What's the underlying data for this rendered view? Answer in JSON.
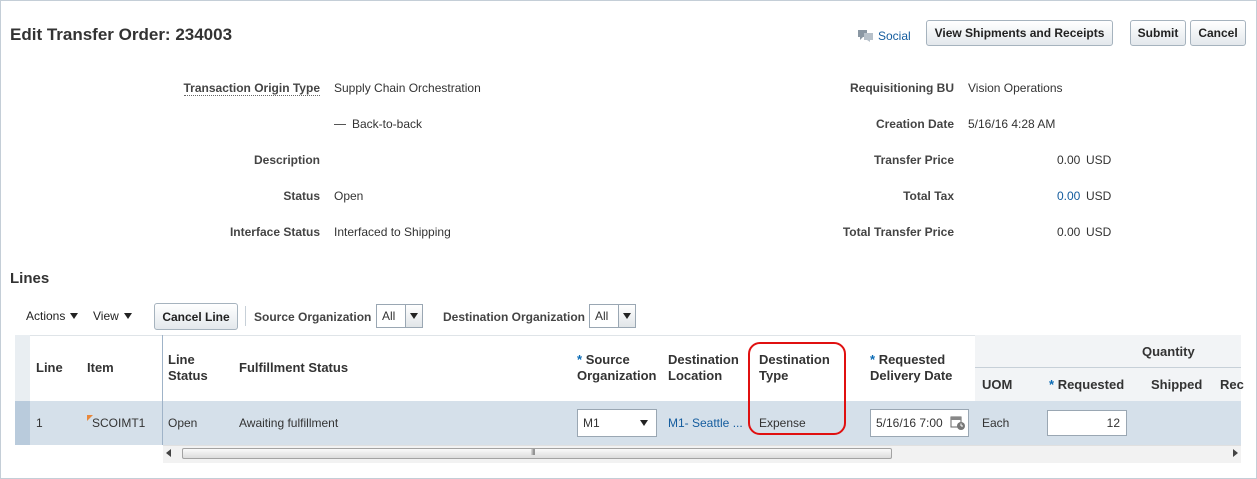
{
  "header": {
    "title": "Edit Transfer Order: 234003",
    "social_label": "Social",
    "view_shipments_label": "View Shipments and Receipts",
    "submit_label": "Submit",
    "cancel_label": "Cancel"
  },
  "details": {
    "transaction_origin_type_label": "Transaction Origin Type",
    "transaction_origin_type_value": "Supply Chain Orchestration",
    "back_to_back": "Back-to-back",
    "description_label": "Description",
    "status_label": "Status",
    "status_value": "Open",
    "interface_status_label": "Interface Status",
    "interface_status_value": "Interfaced to Shipping",
    "requisitioning_bu_label": "Requisitioning BU",
    "requisitioning_bu_value": "Vision Operations",
    "creation_date_label": "Creation Date",
    "creation_date_value": "5/16/16 4:28 AM",
    "transfer_price_label": "Transfer Price",
    "transfer_price_value": "0.00",
    "total_tax_label": "Total Tax",
    "total_tax_value": "0.00",
    "total_transfer_price_label": "Total Transfer Price",
    "total_transfer_price_value": "0.00",
    "currency": "USD"
  },
  "lines": {
    "title": "Lines",
    "toolbar": {
      "actions_label": "Actions",
      "view_label": "View",
      "cancel_line_label": "Cancel Line",
      "source_org_label": "Source Organization",
      "source_org_value": "All",
      "dest_org_label": "Destination Organization",
      "dest_org_value": "All"
    },
    "columns": {
      "line": "Line",
      "item": "Item",
      "line_status_1": "Line",
      "line_status_2": "Status",
      "fulfillment_status": "Fulfillment Status",
      "source_org_1": "Source",
      "source_org_2": "Organization",
      "dest_location_1": "Destination",
      "dest_location_2": "Location",
      "dest_type_1": "Destination",
      "dest_type_2": "Type",
      "req_delivery_1": "Requested",
      "req_delivery_2": "Delivery Date",
      "quantity": "Quantity",
      "uom": "UOM",
      "requested": "Requested",
      "shipped": "Shipped",
      "received": "Rec"
    },
    "required_marker": "*",
    "rows": [
      {
        "line": "1",
        "item": "SCOIMT1",
        "line_status": "Open",
        "fulfillment_status": "Awaiting fulfillment",
        "source_org": "M1",
        "dest_location": "M1- Seattle ...",
        "dest_type": "Expense",
        "req_delivery_date": "5/16/16 7:00",
        "uom": "Each",
        "requested_qty": "12"
      }
    ],
    "scroll_grip": "III"
  }
}
